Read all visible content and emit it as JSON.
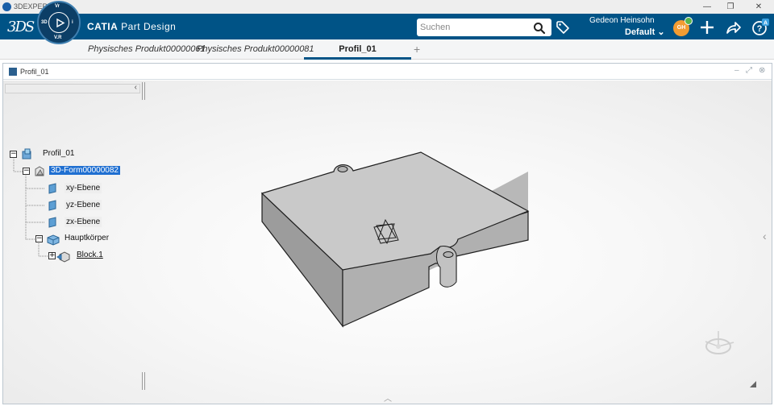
{
  "os_window": {
    "title": "3DEXPERIENCE",
    "controls": [
      "—",
      "❐",
      "✕"
    ]
  },
  "header": {
    "app_name": "CATIA",
    "app_module": "Part Design",
    "compass_labels": [
      "3D",
      "V.R",
      "Vr",
      "i"
    ],
    "search_placeholder": "Suchen",
    "user_name": "Gedeon Heinsohn",
    "tenant": "Default",
    "avatar_initials": "GH",
    "colors": {
      "bar": "#005386",
      "avatar": "#f39c32",
      "status_ok": "#58b44b"
    }
  },
  "tabs": {
    "items": [
      {
        "label": "Physisches Produkt00000061"
      },
      {
        "label": "Physisches Produkt00000081"
      }
    ],
    "active": "Profil_01",
    "add_label": "+"
  },
  "document": {
    "title": "Profil_01"
  },
  "tree": {
    "root": "Profil_01",
    "geoset": "3D-Form00000082",
    "planes": [
      "xy-Ebene",
      "yz-Ebene",
      "zx-Ebene"
    ],
    "body": "Hauptkörper",
    "feature": "Block.1"
  }
}
